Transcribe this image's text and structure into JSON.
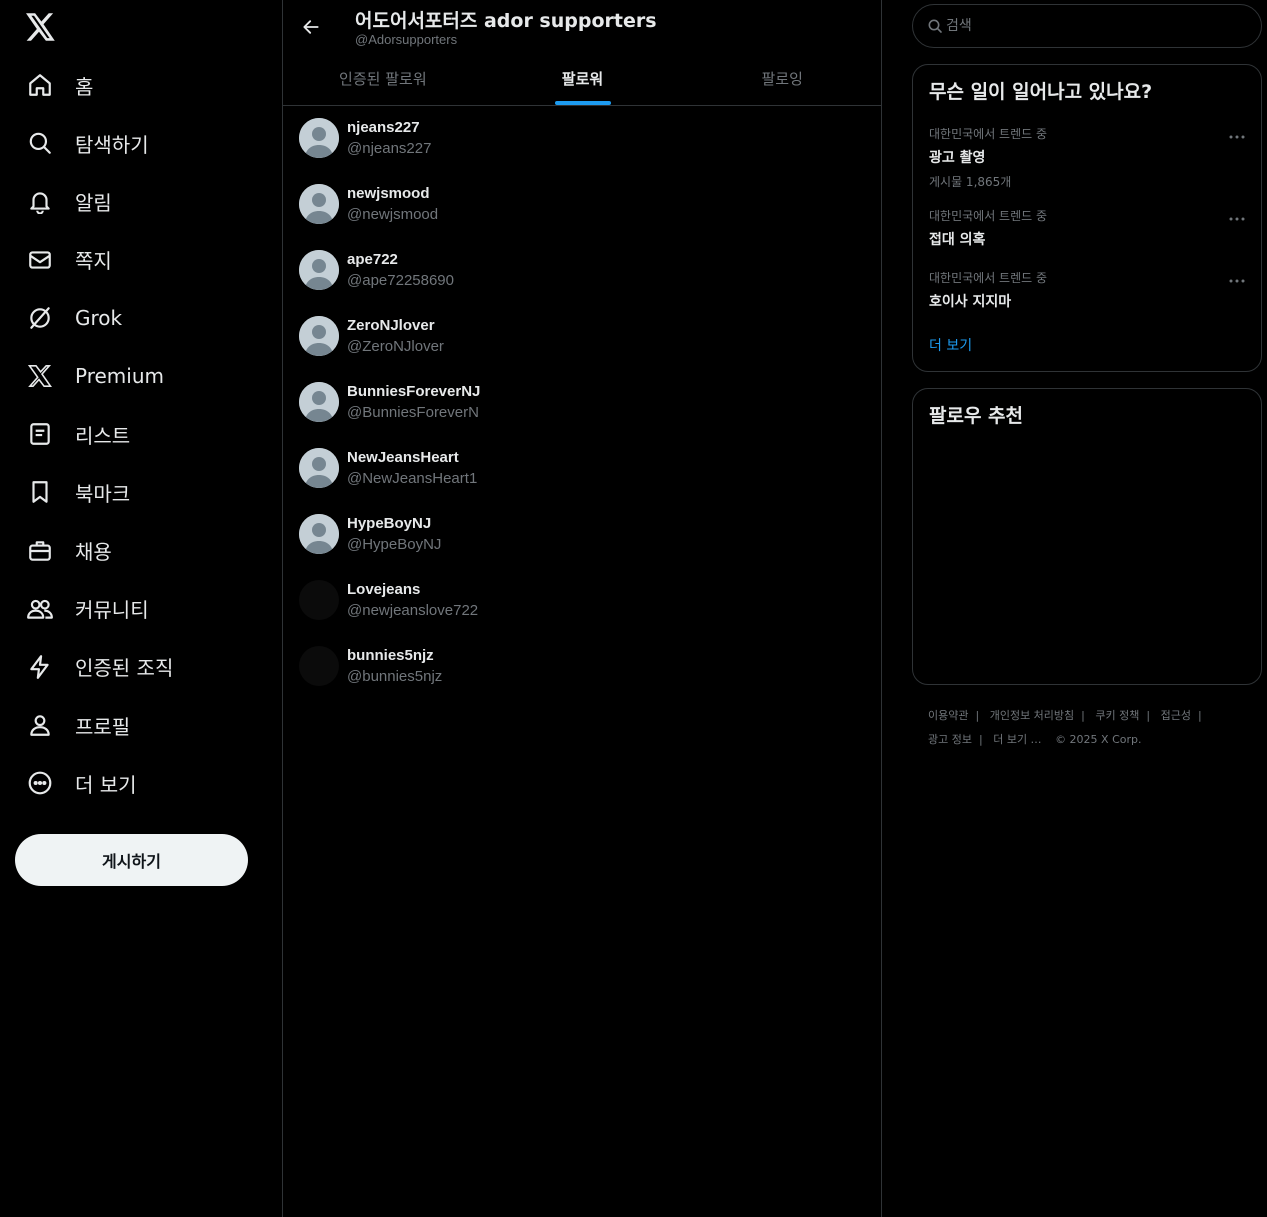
{
  "sidebar": {
    "items": [
      {
        "label": "홈",
        "icon": "home-icon"
      },
      {
        "label": "탐색하기",
        "icon": "search-icon"
      },
      {
        "label": "알림",
        "icon": "bell-icon"
      },
      {
        "label": "쪽지",
        "icon": "envelope-icon"
      },
      {
        "label": "Grok",
        "icon": "grok-icon"
      },
      {
        "label": "Premium",
        "icon": "x-logo-icon"
      },
      {
        "label": "리스트",
        "icon": "list-icon"
      },
      {
        "label": "북마크",
        "icon": "bookmark-icon"
      },
      {
        "label": "채용",
        "icon": "briefcase-icon"
      },
      {
        "label": "커뮤니티",
        "icon": "people-icon"
      },
      {
        "label": "인증된 조직",
        "icon": "lightning-icon"
      },
      {
        "label": "프로필",
        "icon": "person-icon"
      },
      {
        "label": "더 보기",
        "icon": "more-circle-icon"
      }
    ],
    "post_label": "게시하기"
  },
  "header": {
    "title": "어도어서포터즈 ador supporters",
    "handle": "@Adorsupporters"
  },
  "tabs": [
    {
      "label": "인증된 팔로워",
      "active": false
    },
    {
      "label": "팔로워",
      "active": true
    },
    {
      "label": "팔로잉",
      "active": false
    }
  ],
  "followers": [
    {
      "name": "njeans227",
      "handle": "@njeans227",
      "avatar": "default"
    },
    {
      "name": "newjsmood",
      "handle": "@newjsmood",
      "avatar": "default"
    },
    {
      "name": "ape722",
      "handle": "@ape72258690",
      "avatar": "default"
    },
    {
      "name": "ZeroNJlover",
      "handle": "@ZeroNJlover",
      "avatar": "default"
    },
    {
      "name": "BunniesForeverNJ",
      "handle": "@BunniesForeverN",
      "avatar": "default"
    },
    {
      "name": "NewJeansHeart",
      "handle": "@NewJeansHeart1",
      "avatar": "default"
    },
    {
      "name": "HypeBoyNJ",
      "handle": "@HypeBoyNJ",
      "avatar": "default"
    },
    {
      "name": "Lovejeans",
      "handle": "@newjeanslove722",
      "avatar": "dark"
    },
    {
      "name": "bunnies5njz",
      "handle": "@bunnies5njz",
      "avatar": "dark"
    }
  ],
  "search": {
    "placeholder": "검색"
  },
  "trends": {
    "title": "무슨 일이 일어나고 있나요?",
    "items": [
      {
        "context": "대한민국에서 트렌드 중",
        "name": "광고 촬영",
        "count": "게시물 1,865개"
      },
      {
        "context": "대한민국에서 트렌드 중",
        "name": "접대 의혹",
        "count": ""
      },
      {
        "context": "대한민국에서 트렌드 중",
        "name": "호이사 지지마",
        "count": ""
      }
    ],
    "show_more": "더 보기"
  },
  "who_to_follow": {
    "title": "팔로우 추천"
  },
  "footer": {
    "links": [
      "이용약관",
      "개인정보 처리방침",
      "쿠키 정책",
      "접근성",
      "광고 정보",
      "더 보기 …"
    ],
    "copyright": "© 2025 X Corp."
  },
  "colors": {
    "accent": "#1d9bf0",
    "background": "#000000",
    "border": "#2f3336",
    "muted": "#71767b"
  }
}
